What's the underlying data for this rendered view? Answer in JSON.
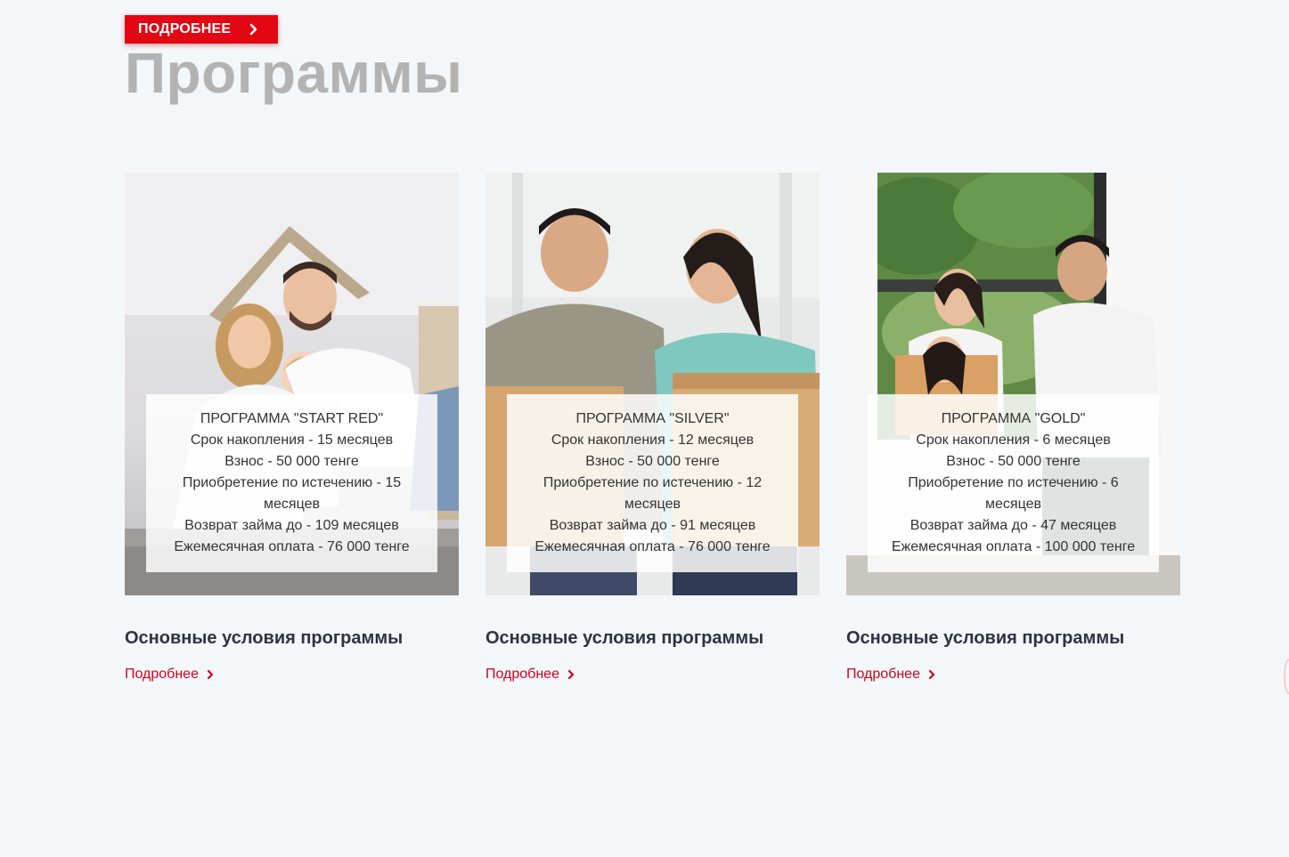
{
  "header": {
    "more_button_label": "ПОДРОБНЕЕ",
    "title": "Программы"
  },
  "colors": {
    "accent": "#e30613",
    "link": "#d0021b",
    "title_gray": "#b3b3b3",
    "background": "#f4f7fa"
  },
  "cards": [
    {
      "name": "ПРОГРАММА \"START RED\"",
      "term": "Срок накопления - 15 месяцев",
      "fee": "Взнос - 50 000 тенге",
      "purchase": "Приобретение по истечению - 15 месяцев",
      "repay": "Возврат займа до - 109 месяцев",
      "monthly": "Ежемесячная оплата - 76 000 тенге",
      "title": "Основные условия программы",
      "link": "Подробнее"
    },
    {
      "name": "ПРОГРАММА \"SILVER\"",
      "term": "Срок накопления - 12 месяцев",
      "fee": "Взнос - 50 000 тенге",
      "purchase": "Приобретение по истечению - 12 месяцев",
      "repay": "Возврат займа до - 91 месяцев",
      "monthly": "Ежемесячная оплата - 76 000 тенге",
      "title": "Основные условия программы",
      "link": "Подробнее"
    },
    {
      "name": "ПРОГРАММА \"GOLD\"",
      "term": "Срок накопления - 6 месяцев",
      "fee": "Взнос - 50 000 тенге",
      "purchase": "Приобретение по истечению - 6 месяцев",
      "repay": "Возврат займа до - 47 месяцев",
      "monthly": "Ежемесячная оплата - 100 000 тенге",
      "title": "Основные условия программы",
      "link": "Подробнее"
    }
  ]
}
